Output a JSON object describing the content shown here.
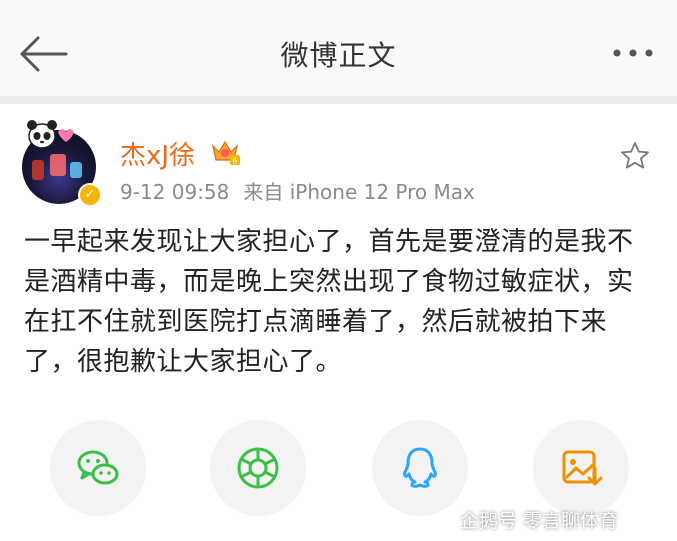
{
  "header": {
    "title": "微博正文"
  },
  "post": {
    "author": "杰xJ徐",
    "vip_level": "6",
    "time": "9-12 09:58",
    "source": "来自 iPhone 12 Pro Max",
    "text": "一早起来发现让大家担心了，首先是要澄清的是我不是酒精中毒，而是晚上突然出现了食物过敏症状，实在扛不住就到医院打点滴睡着了，然后就被拍下来了，很抱歉让大家担心了。"
  },
  "share": [
    {
      "icon": "wechat-icon",
      "color": "#3cbf4a"
    },
    {
      "icon": "moments-icon",
      "color": "#3cbf4a"
    },
    {
      "icon": "qq-icon",
      "color": "#2aa6ff"
    },
    {
      "icon": "save-image-icon",
      "color": "#f29100"
    }
  ],
  "watermark": {
    "text": "企鹅号 零言聊体育"
  },
  "colors": {
    "username": "#e86a1b",
    "verify": "#f7b500",
    "meta": "#8a8a8a"
  }
}
